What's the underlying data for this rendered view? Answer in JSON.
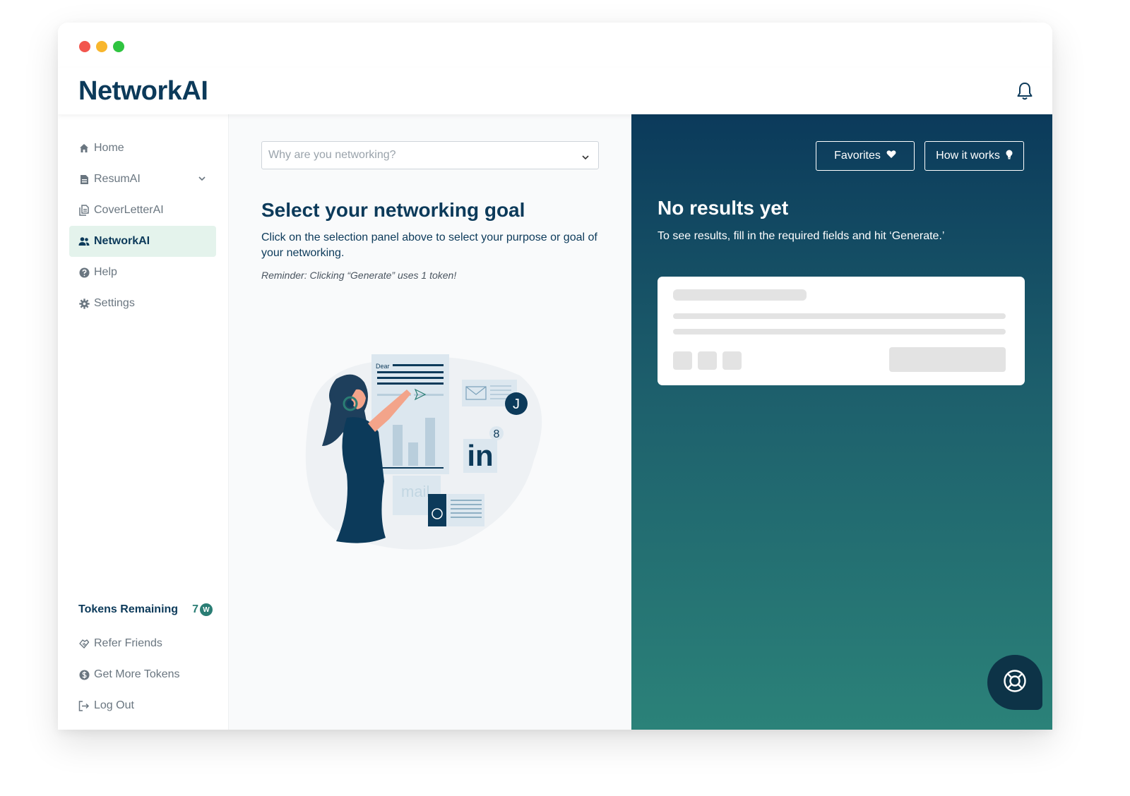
{
  "app": {
    "logo": "NetworkAI",
    "bell_icon": "bell-icon"
  },
  "sidebar": {
    "items": [
      {
        "label": "Home",
        "icon": "home-icon"
      },
      {
        "label": "ResumAI",
        "icon": "document-icon"
      },
      {
        "label": "CoverLetterAI",
        "icon": "file-stack-icon"
      },
      {
        "label": "NetworkAI",
        "icon": "users-icon"
      },
      {
        "label": "Help",
        "icon": "question-icon"
      },
      {
        "label": "Settings",
        "icon": "gear-icon"
      }
    ],
    "tokens_label": "Tokens Remaining",
    "tokens_count": "7",
    "bottom_items": [
      {
        "label": "Refer Friends",
        "icon": "handshake-icon"
      },
      {
        "label": "Get More Tokens",
        "icon": "dollar-coin-icon"
      },
      {
        "label": "Log Out",
        "icon": "logout-icon"
      }
    ]
  },
  "main": {
    "select_placeholder": "Why are you networking?",
    "title": "Select your networking goal",
    "description": "Click on the selection panel above to select your purpose or goal of your networking.",
    "reminder": "Reminder: Clicking “Generate” uses 1 token!",
    "illustration": {
      "letter_text": "Dear",
      "avatar_letter": "J",
      "linkedin_text": "in",
      "notification_count": "8",
      "mail_text": "mail"
    }
  },
  "results": {
    "favorites_label": "Favorites",
    "how_label": "How it works",
    "title": "No results yet",
    "description": "To see results, fill in the required fields and hit ‘Generate.’"
  },
  "colors": {
    "brand_navy": "#0c3a5a",
    "accent_green": "#2a7d74",
    "active_bg": "#e4f3ec",
    "gradient_top": "#0b3a5b",
    "gradient_bottom": "#2b8279"
  }
}
